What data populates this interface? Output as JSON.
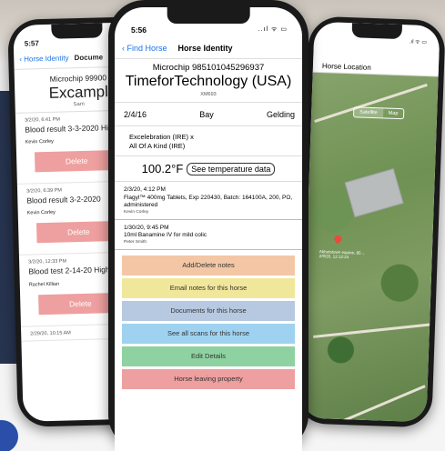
{
  "left_phone": {
    "status_time": "5:57",
    "back_label": "Horse Identity",
    "nav_title": "Docume",
    "microchip": "Microchip 99900",
    "horse_name": "Excampl",
    "sub": "Sam",
    "notes": [
      {
        "ts": "3/2/20, 6:41 PM",
        "text": "Blood result 3-3-2020 High gGT",
        "by": "Kevin Corley"
      },
      {
        "ts": "3/2/20, 6:39 PM",
        "text": "Blood result 3-2-2020",
        "by": "Kevin Corley"
      },
      {
        "ts": "3/2/20, 12:33 PM",
        "text": "Blood test 2-14-20 High SAA",
        "by": "Rachel Killian"
      }
    ],
    "last_ts": "2/29/20, 10:15 AM",
    "delete_label": "Delete"
  },
  "center_phone": {
    "status_time": "5:56",
    "status_icons": "..ıl ᯤ ▭",
    "back_label": "Find Horse",
    "nav_title": "Horse Identity",
    "microchip": "Microchip 985101045296937",
    "horse_name": "TimeforTechnology (USA)",
    "sub": "XM693",
    "dob": "2/4/16",
    "color": "Bay",
    "sex": "Gelding",
    "pedigree_line1": "Excelebration (IRE) x",
    "pedigree_line2": "All Of A Kind (IRE)",
    "temperature": "100.2°F",
    "temp_button": "See temperature data",
    "notes": [
      {
        "ts": "2/3/20, 4:12 PM",
        "text": "Flagyl™ 400mg Tablets, Exp 220430, Batch: 164100A, 200, PO, administered",
        "by": "Kevin Corley"
      },
      {
        "ts": "1/30/20, 9:45 PM",
        "text": "10ml Banamine IV for mild colic",
        "by": "Peter Smith"
      }
    ],
    "actions": [
      {
        "label": "Add/Delete notes",
        "color": "#f3c7a6"
      },
      {
        "label": "Email notes for this horse",
        "color": "#f1e79b"
      },
      {
        "label": "Documents for this horse",
        "color": "#b7c9e0"
      },
      {
        "label": "See all scans for this horse",
        "color": "#9fd2f0"
      },
      {
        "label": "Edit Details",
        "color": "#8fd2a1"
      },
      {
        "label": "Horse leaving property",
        "color": "#ee9f9f"
      }
    ]
  },
  "right_phone": {
    "nav_title": "Horse Location",
    "satellite": "Satellite",
    "map": "Map",
    "pin_label": "Abbotstown equine, 85 ·, 2/9/20, 12:12:24"
  }
}
